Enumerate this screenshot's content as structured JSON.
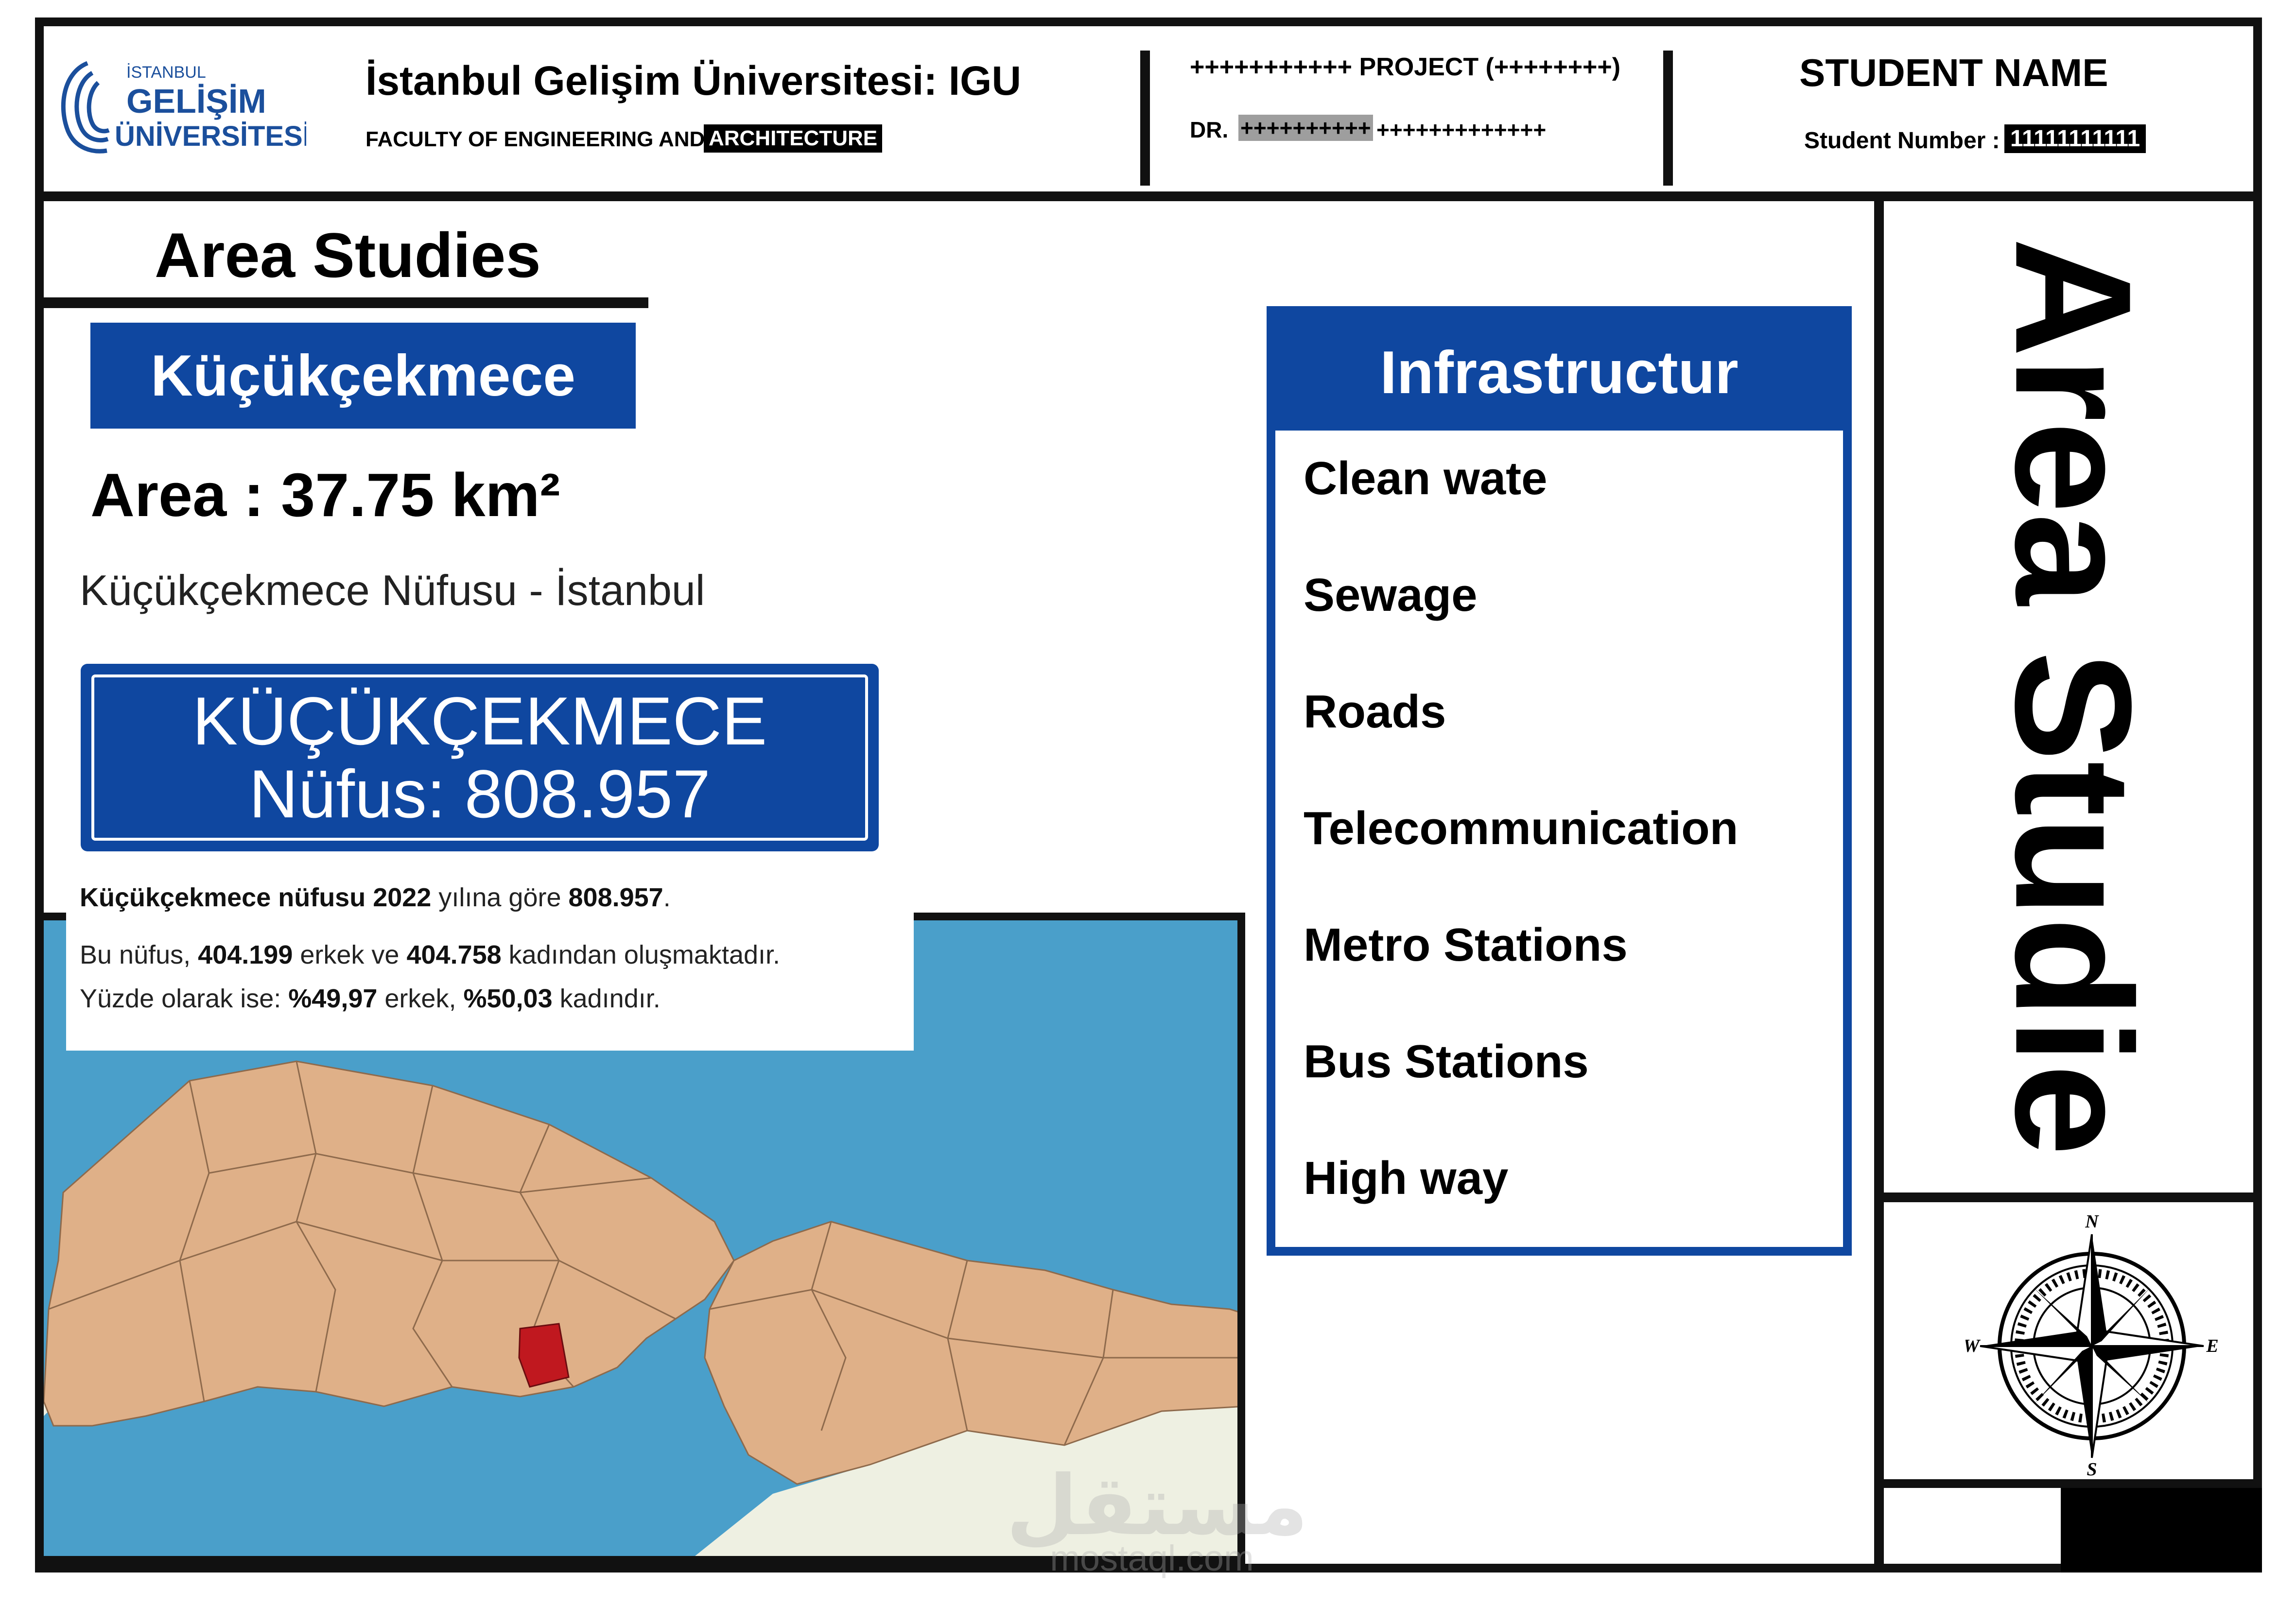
{
  "header": {
    "logo": {
      "line1": "İSTANBUL",
      "line2": "GELİŞİM",
      "line3": "ÜNİVERSİTESİ",
      "color": "#1b4f9c"
    },
    "university_title": "İstanbul Gelişim Üniversitesi: IGU",
    "faculty_part1": "FACULTY OF ENGINEERING AND",
    "faculty_part2": "ARCHITECTURE",
    "project_line": "+++++++++++ PROJECT (++++++++)",
    "dr_prefix": "DR.",
    "dr_highlighted": "++++++++++",
    "dr_rest": "+++++++++++++",
    "student_name": "STUDENT NAME",
    "student_number_label": "Student Number :",
    "student_number_value": "11111111111"
  },
  "area_studies": {
    "heading": "Area Studies",
    "district": "Küçükçekmece",
    "area": "Area : 37.75 km²",
    "population_caption": "Küçükçekmece Nüfusu - İstanbul",
    "sign_line1": "KÜÇÜKÇEKMECE",
    "sign_line2": "Nüfus: 808.957"
  },
  "population_note": {
    "line1_b1": "Küçükçekmece nüfusu 2022",
    "line1_t1": " yılına göre ",
    "line1_b2": "808.957",
    "line1_t2": ".",
    "line2_t1": "Bu nüfus, ",
    "line2_b1": "404.199",
    "line2_t2": " erkek ve ",
    "line2_b2": "404.758",
    "line2_t3": " kadından oluşmaktadır.",
    "line3_t1": "Yüzde olarak ise: ",
    "line3_b1": "%49,97",
    "line3_t2": " erkek, ",
    "line3_b2": "%50,03",
    "line3_t3": " kadındır."
  },
  "map": {
    "sea_color": "#4a9fca",
    "land_color": "#dfb088",
    "highlight_color": "#c0181f",
    "outside_color": "#eef0e2"
  },
  "infrastructure": {
    "title": "Infrastructur",
    "items": [
      "Clean wate",
      "Sewage",
      "Roads",
      "Telecommunication",
      "Metro Stations",
      "Bus Stations",
      "High way"
    ]
  },
  "side_title": "Area Studie",
  "compass": {
    "north": "N",
    "south": "S",
    "east": "E",
    "west": "W"
  },
  "watermark": {
    "arabic": "مستقل",
    "latin": "mostaql.com"
  },
  "colors": {
    "brand_blue": "#0f47a0",
    "frame": "#111111"
  }
}
